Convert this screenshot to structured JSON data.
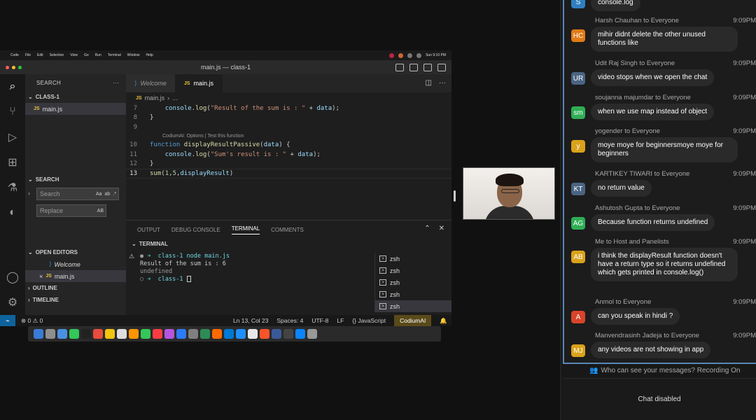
{
  "mac_menubar": {
    "items": [
      "Code",
      "File",
      "Edit",
      "Selection",
      "View",
      "Go",
      "Run",
      "Terminal",
      "Window",
      "Help"
    ],
    "clock": "Sun 9:10 PM"
  },
  "vscode": {
    "window_title": "main.js — class-1",
    "sidebar": {
      "header": "SEARCH",
      "folder": "CLASS-1",
      "file": "main.js",
      "search_section": "SEARCH",
      "search_placeholder": "Search",
      "search_opts": [
        "Aa",
        "ab",
        ".*"
      ],
      "replace_placeholder": "Replace",
      "replace_opt": "AB",
      "open_editors": "OPEN EDITORS",
      "open_items": [
        "Welcome",
        "main.js"
      ],
      "outline": "OUTLINE",
      "timeline": "TIMELINE"
    },
    "tabs": [
      "Welcome",
      "main.js"
    ],
    "breadcrumb": [
      "main.js",
      "..."
    ],
    "code": {
      "line7": "7",
      "line8": "8",
      "line9": "9",
      "line10": "10",
      "line11": "11",
      "line12": "12",
      "line13": "13",
      "codelens": "CodiumAI: Options | Test this function"
    },
    "panel": {
      "tabs": [
        "OUTPUT",
        "DEBUG CONSOLE",
        "TERMINAL",
        "COMMENTS"
      ],
      "terminal_header": "TERMINAL",
      "lines": [
        "class-1 node main.js",
        "Result of the sum is : 6",
        "undefined",
        "class-1"
      ],
      "terminals": [
        "zsh",
        "zsh",
        "zsh",
        "zsh",
        "zsh"
      ]
    },
    "status": {
      "errors": "0",
      "warnings": "0",
      "cursor": "Ln 13, Col 23",
      "spaces": "Spaces: 4",
      "encoding": "UTF-8",
      "eol": "LF",
      "language": "JavaScript",
      "codium": "CodiumAI"
    }
  },
  "chat": {
    "messages": [
      {
        "initials": "S",
        "color": "#2f7fc1",
        "sender": "",
        "time": "",
        "text": "console.log"
      },
      {
        "initials": "HC",
        "color": "#e07b17",
        "sender": "Harsh Chauhan to Everyone",
        "time": "9:09PM",
        "text": "mihir didnt delete the other unused functions like"
      },
      {
        "initials": "UR",
        "color": "#4a6482",
        "sender": "Udit Raj Singh to Everyone",
        "time": "9:09PM",
        "text": "video stops when we open the chat"
      },
      {
        "initials": "sm",
        "color": "#2fae55",
        "sender": "soujanna majumdar to Everyone",
        "time": "9:09PM",
        "text": "when we use map instead of object"
      },
      {
        "initials": "y",
        "color": "#d9a21b",
        "sender": "yogender to Everyone",
        "time": "9:09PM",
        "text": "moye moye for beginnersmoye moye for beginners"
      },
      {
        "initials": "KT",
        "color": "#4a6482",
        "sender": "KARTIKEY TIWARI to Everyone",
        "time": "9:09PM",
        "text": "no return value"
      },
      {
        "initials": "AG",
        "color": "#2fae55",
        "sender": "Ashutosh Gupta to Everyone",
        "time": "9:09PM",
        "text": "Because function returns undefined"
      },
      {
        "initials": "AB",
        "color": "#d9a21b",
        "sender": "Me to Host and Panelists",
        "time": "9:09PM",
        "text": "i think the displayResult function doesn't have a return type so it returns undefined which gets printed in console.log()"
      },
      {
        "initials": "A",
        "color": "#d9442a",
        "sender": "Anmol to Everyone",
        "time": "9:09PM",
        "text": "can you speak in hindi ?"
      },
      {
        "initials": "MJ",
        "color": "#d9a21b",
        "sender": "Manvendrasinh Jadeja to Everyone",
        "time": "9:09PM",
        "text": "any videos are not showing in app"
      }
    ],
    "footer": "Who can see your messages? Recording On",
    "disabled": "Chat disabled"
  }
}
